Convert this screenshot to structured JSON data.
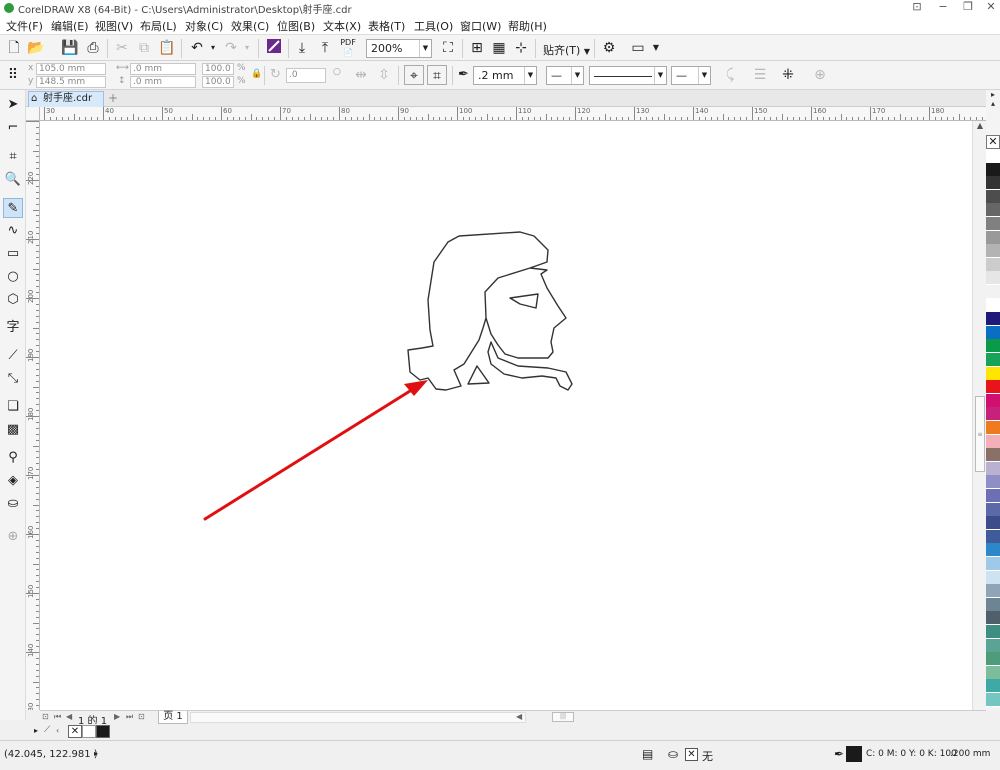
{
  "window": {
    "title": "CorelDRAW X8 (64-Bit) - C:\\Users\\Administrator\\Desktop\\射手座.cdr"
  },
  "menu": [
    "文件(F)",
    "编辑(E)",
    "视图(V)",
    "布局(L)",
    "对象(C)",
    "效果(C)",
    "位图(B)",
    "文本(X)",
    "表格(T)",
    "工具(O)",
    "窗口(W)",
    "帮助(H)"
  ],
  "toolbar": {
    "zoom": "200%",
    "snap_label": "贴齐(T)",
    "pdf_label": "PDF"
  },
  "propbar": {
    "x": "105.0 mm",
    "y": "148.5 mm",
    "w": ".0 mm",
    "h": ".0 mm",
    "sx": "100.0",
    "sy": "100.0",
    "pct": "%",
    "angle": ".0",
    "outline_width": ".2 mm"
  },
  "tab": {
    "name": "射手座.cdr"
  },
  "ruler": {
    "h_labels": [
      "30",
      "40",
      "50",
      "60",
      "70",
      "80",
      "90",
      "100",
      "110",
      "120",
      "130",
      "140",
      "150",
      "160",
      "170",
      "180"
    ],
    "v_labels": [
      "220",
      "210",
      "200",
      "190",
      "180",
      "170",
      "160",
      "150",
      "140",
      "130"
    ]
  },
  "pagenav": {
    "page_info": "1 的 1",
    "page_tab": "页 1"
  },
  "status": {
    "coords": "(42.045, 122.981 )",
    "fill_none": "无",
    "outline_color": "C: 0 M: 0 Y: 0 K: 100",
    "outline_width": ".200 mm"
  },
  "palette": [
    "#ffffff",
    "#1a1a1a",
    "#333333",
    "#4d4d4d",
    "#666666",
    "#808080",
    "#999999",
    "#b3b3b3",
    "#cccccc",
    "#e6e6e6",
    "#f2f2f2",
    "#ffffff",
    "#1f1a7a",
    "#0a6fc2",
    "#0a9a4a",
    "#17a35a",
    "#ffe600",
    "#e8141b",
    "#d10f6e",
    "#c7207d",
    "#ee7b1e",
    "#f3b0b8",
    "#8a7167",
    "#b9b0d2",
    "#8f8fc6",
    "#6c6fb5",
    "#5b69a8",
    "#3c4b8a",
    "#3f5b99",
    "#2c88c9",
    "#9ec9e8",
    "#cde3f2",
    "#8fa5b7",
    "#6d8493",
    "#4f606b",
    "#3e8f82",
    "#5aa395",
    "#4f9c7c",
    "#7dbd9c",
    "#3fa9a5",
    "#74c6c0"
  ],
  "colors": {
    "arrow": "#e01010",
    "accent": "#2f7bd6"
  }
}
